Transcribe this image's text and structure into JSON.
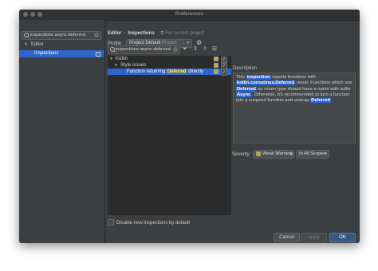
{
  "window": {
    "title": "Preferences"
  },
  "sidebar": {
    "search_value": "inspections async deferred",
    "editor_label": "Editor",
    "selected_item": "Inspections"
  },
  "header": {
    "crumb_editor": "Editor",
    "crumb_sep": "›",
    "crumb_inspections": "Inspections",
    "crumb_note": "For current project"
  },
  "profile": {
    "label": "Profile:",
    "value": "Project Default",
    "suffix": "Project"
  },
  "inspections_search": {
    "value": "inspections async deferred"
  },
  "tree": {
    "kotlin": "Kotlin",
    "style_issues": "Style issues",
    "item_before": "Function returning ",
    "item_highlight": "Deferred",
    "item_after": " directly"
  },
  "description": {
    "label": "Description",
    "p1": "This ",
    "k1": "inspection",
    "p2": " reports functions with ",
    "k2": "kotlin.coroutines.Deferred",
    "p3": " result. Functions which use ",
    "k3": "Deferred",
    "p4": " as return type should have a name with suffix ",
    "k4": "Async",
    "p5": ". Otherwise, it's recommended to turn a function into a suspend function and unwrap ",
    "k5": "Deferred",
    "p6": "."
  },
  "severity": {
    "label": "Severity:",
    "value": "Weak Warning",
    "scope": "In All Scopes",
    "swatch_color": "#b0a869"
  },
  "disable_new": "Disable new inspections by default",
  "buttons": {
    "cancel": "Cancel",
    "apply": "Apply",
    "ok": "OK",
    "help": "?"
  },
  "colors": {
    "selection": "#2f65ca",
    "highlight": "#7f7f3a"
  }
}
